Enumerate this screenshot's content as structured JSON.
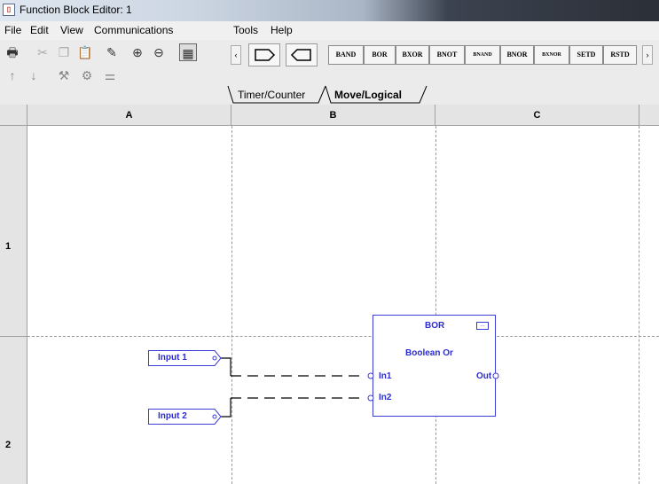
{
  "window": {
    "title": "Function Block Editor: 1"
  },
  "menu": [
    "File",
    "Edit",
    "View",
    "Communications",
    "Tools",
    "Help"
  ],
  "toolbar": {
    "icons_row1": [
      "print-icon",
      "cut-icon",
      "copy-icon",
      "paste-icon",
      "edit-icon",
      "zoom-in-icon",
      "zoom-out-icon",
      "edit-mode-icon"
    ],
    "icons_row2": [
      "up-arrow-icon",
      "down-arrow-icon",
      "tool-icon",
      "settings-icon",
      "network-icon"
    ],
    "block_buttons": [
      "BAND",
      "BOR",
      "BXOR",
      "BNOT",
      "BNAND",
      "BNOR",
      "BXNOR",
      "SETD",
      "RSTD"
    ]
  },
  "tabs": {
    "tab1": "Timer/Counter",
    "tab2": "Move/Logical"
  },
  "grid": {
    "columns": [
      "A",
      "B",
      "C"
    ],
    "rows": [
      "1",
      "2"
    ]
  },
  "diagram": {
    "inputs": {
      "in1": "Input 1",
      "in2": "Input 2"
    },
    "block": {
      "name": "BOR",
      "description": "Boolean Or",
      "pin_in1": "In1",
      "pin_in2": "In2",
      "pin_out": "Out"
    }
  }
}
